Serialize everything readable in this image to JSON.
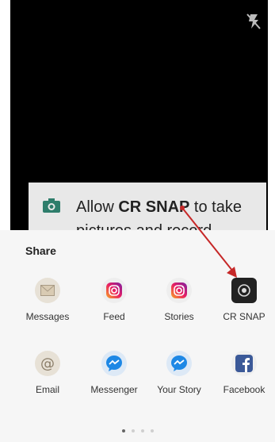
{
  "permission": {
    "prefix": "Allow ",
    "app_name": "CR SNAP",
    "suffix": " to take",
    "line2": "pictures and record"
  },
  "share": {
    "title": "Share",
    "apps": [
      {
        "label": "Messages",
        "icon": "messages-envelope-icon"
      },
      {
        "label": "Feed",
        "icon": "instagram-icon"
      },
      {
        "label": "Stories",
        "icon": "instagram-icon"
      },
      {
        "label": "CR SNAP",
        "icon": "cr-snap-icon"
      },
      {
        "label": "Email",
        "icon": "email-at-icon"
      },
      {
        "label": "Messenger",
        "icon": "messenger-icon"
      },
      {
        "label": "Your Story",
        "icon": "messenger-icon"
      },
      {
        "label": "Facebook",
        "icon": "facebook-icon"
      }
    ],
    "page_dots": 4,
    "active_page": 1
  },
  "colors": {
    "annotation_arrow": "#c62828",
    "permission_icon": "#2e7d6b",
    "messenger_blue": "#1e88e5",
    "facebook_blue": "#3b5998"
  }
}
